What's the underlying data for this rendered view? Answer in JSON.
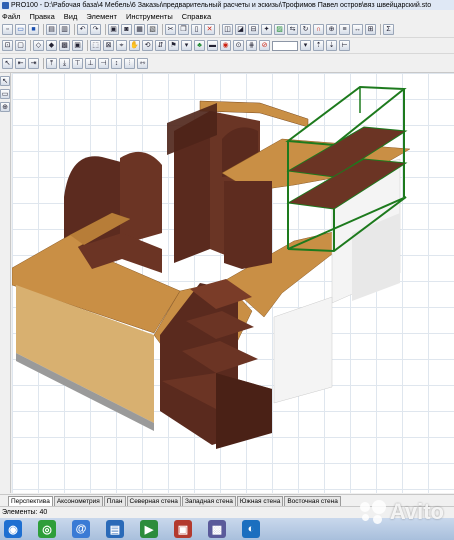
{
  "window": {
    "title": "PRO100 - D:\\Рабочая база\\4 Мебель\\6 Заказы\\предварительный расчеты и эскизы\\Трофимов Павел остров\\вяз швейцарский.sto"
  },
  "menu": [
    "Файл",
    "Правка",
    "Вид",
    "Элемент",
    "Инструменты",
    "Справка"
  ],
  "toolbar": {
    "sigma_label": "Σ"
  },
  "view_tabs": [
    "Перспектива",
    "Аксонометрия",
    "План",
    "Северная стена",
    "Западная стена",
    "Южная стена",
    "Восточная стена"
  ],
  "active_tab": "Перспектива",
  "status": {
    "elements_text": "Элементы: 40"
  },
  "watermark": "Avito",
  "colors": {
    "wood_top": "#c98f45",
    "wood_dark": "#5a2a1e",
    "panel_light": "#d8b070",
    "white_panel": "#f4f4f4",
    "frame_green": "#1d7a1d"
  }
}
